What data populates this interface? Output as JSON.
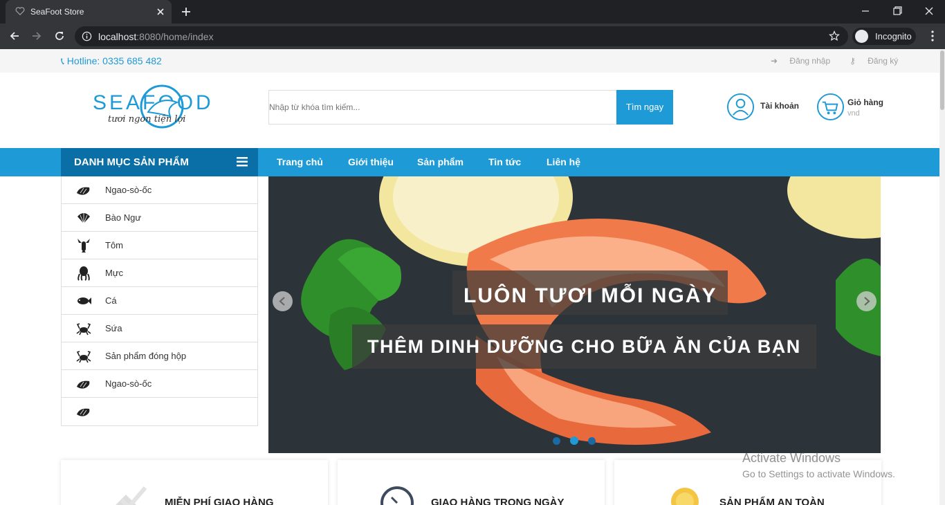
{
  "browser": {
    "tab_title": "SeaFoot Store",
    "url_host": "localhost",
    "url_rest": ":8080/home/index",
    "profile_label": "Incognito"
  },
  "topbar": {
    "hotline": "Hotline: 0335 685 482",
    "login": "Đăng nhập",
    "register": "Đăng ký"
  },
  "header": {
    "logo_text": "SEAFOOD",
    "logo_tagline": "tươi ngon   tiện lợi",
    "search_placeholder": "Nhập từ khóa tìm kiếm...",
    "search_button": "Tìm ngay",
    "account_label": "Tài khoản",
    "cart_label": "Giỏ hàng",
    "cart_sub": "vnd"
  },
  "nav": {
    "category_title": "DANH MỤC SẢN PHẨM",
    "links": [
      "Trang chủ",
      "Giới thiệu",
      "Sản phẩm",
      "Tin tức",
      "Liên hệ"
    ]
  },
  "categories": [
    {
      "label": "Ngao-sò-ốc",
      "icon": "shell-icon"
    },
    {
      "label": "Bào Ngư",
      "icon": "scallop-icon"
    },
    {
      "label": "Tôm",
      "icon": "lobster-icon"
    },
    {
      "label": "Mực",
      "icon": "octopus-icon"
    },
    {
      "label": "Cá",
      "icon": "fish-icon"
    },
    {
      "label": "Sứa",
      "icon": "crab-icon"
    },
    {
      "label": "Sản phẩm đóng hộp",
      "icon": "crab-icon"
    },
    {
      "label": "Ngao-sò-ốc",
      "icon": "shell-icon"
    },
    {
      "label": "",
      "icon": "shell-icon"
    }
  ],
  "slider": {
    "caption_1": "LUÔN TƯƠI MỖI NGÀY",
    "caption_2": "THÊM DINH DƯỠNG CHO BỮA ĂN CỦA BẠN",
    "active_slide": 2,
    "slide_count": 3
  },
  "features": [
    {
      "label": "MIỄN PHÍ GIAO HÀNG",
      "icon": "delivery-icon"
    },
    {
      "label": "GIAO HÀNG TRONG NGÀY",
      "icon": "clock-icon"
    },
    {
      "label": "SẢN PHẨM AN TOÀN",
      "icon": "badge-icon"
    }
  ],
  "watermark": {
    "line1": "Activate Windows",
    "line2": "Go to Settings to activate Windows."
  },
  "colors": {
    "brand_blue": "#1e9ad6",
    "category_header": "#0a6fa6"
  }
}
